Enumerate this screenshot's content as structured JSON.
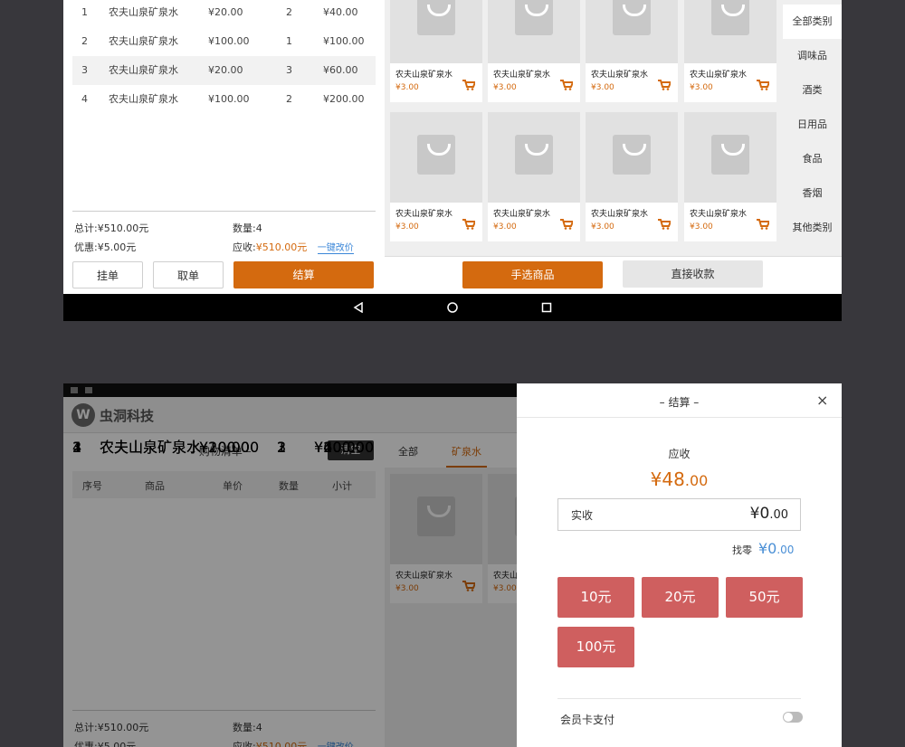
{
  "cart": {
    "items": [
      {
        "no": "1",
        "name": "农夫山泉矿泉水",
        "price": "¥20.00",
        "qty": "2",
        "subtotal": "¥40.00"
      },
      {
        "no": "2",
        "name": "农夫山泉矿泉水",
        "price": "¥100.00",
        "qty": "1",
        "subtotal": "¥100.00"
      },
      {
        "no": "3",
        "name": "农夫山泉矿泉水",
        "price": "¥20.00",
        "qty": "3",
        "subtotal": "¥60.00"
      },
      {
        "no": "4",
        "name": "农夫山泉矿泉水",
        "price": "¥100.00",
        "qty": "2",
        "subtotal": "¥200.00"
      }
    ],
    "title": "– 购物清单 –",
    "clear_label": "清空",
    "headers": [
      "序号",
      "商品",
      "单价",
      "数量",
      "小计"
    ]
  },
  "summary": {
    "total": "总计:¥510.00元",
    "count": "数量:4",
    "discount": "优惠:¥5.00元",
    "receivable_label": "应收:",
    "receivable_value": "¥510.00元",
    "edit_price": "一键改价"
  },
  "actions": {
    "hold": "挂单",
    "fetch": "取单",
    "checkout": "结算",
    "pick": "手选商品",
    "direct": "直接收款"
  },
  "product": {
    "name": "农夫山泉矿泉水",
    "price": "¥3.00"
  },
  "categories": [
    "全部类别",
    "调味品",
    "酒类",
    "日用品",
    "食品",
    "香烟",
    "其他类别"
  ],
  "header": {
    "brand": "虫洞科技",
    "tab_all": "全部",
    "tab_water": "矿泉水"
  },
  "dialog": {
    "title": "– 结算 –",
    "due_label": "应收",
    "due_value": "¥48",
    "due_cents": ".00",
    "paid_label": "实收",
    "paid_value": "¥0",
    "paid_cents": ".00",
    "change_label": "找零",
    "change_value": "¥0",
    "change_cents": ".00",
    "amounts": [
      "10元",
      "20元",
      "50元",
      "100元"
    ],
    "member_label": "会员卡支付"
  }
}
